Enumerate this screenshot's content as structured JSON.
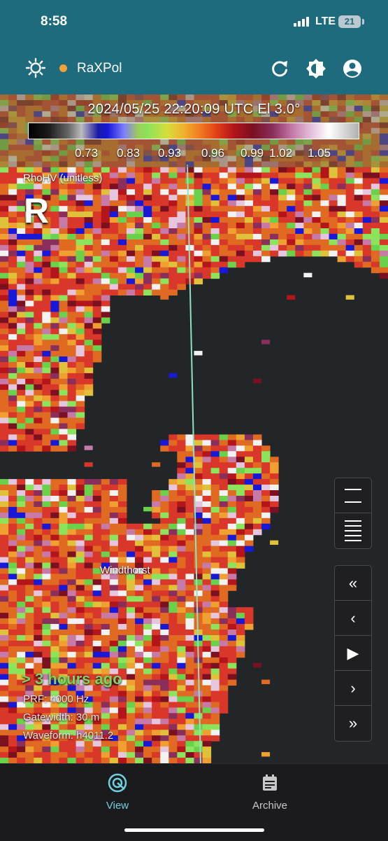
{
  "status_bar": {
    "time": "8:58",
    "network": "LTE",
    "battery": "21"
  },
  "header": {
    "app_name": "RaXPol",
    "status_dot_color": "#f3a23a"
  },
  "legend": {
    "timestamp": "2024/05/25 22:20:09 UTC  El  3.0°",
    "ticks": [
      "0.73",
      "0.83",
      "0.93",
      "0.96",
      "0.99",
      "1.02",
      "1.05"
    ]
  },
  "overlay": {
    "product": "RhoHV (unitless)",
    "mode_letter": "R",
    "town": "Windthorst",
    "age": "> 3 hours ago",
    "prf": "PRF: 4000 Hz",
    "gatewidth": "Gatewidth: 30 m",
    "waveform": "Waveform: h4011.2"
  },
  "controls": {
    "zoom": [
      "expand-layers-icon",
      "list-layers-icon"
    ],
    "playback": [
      "«",
      "‹",
      "▶",
      "›",
      "»"
    ]
  },
  "nav": {
    "items": [
      {
        "label": "View",
        "icon": "radar-view-icon",
        "active": true
      },
      {
        "label": "Archive",
        "icon": "calendar-icon",
        "active": false
      }
    ],
    "active_color": "#6fd0e0"
  }
}
